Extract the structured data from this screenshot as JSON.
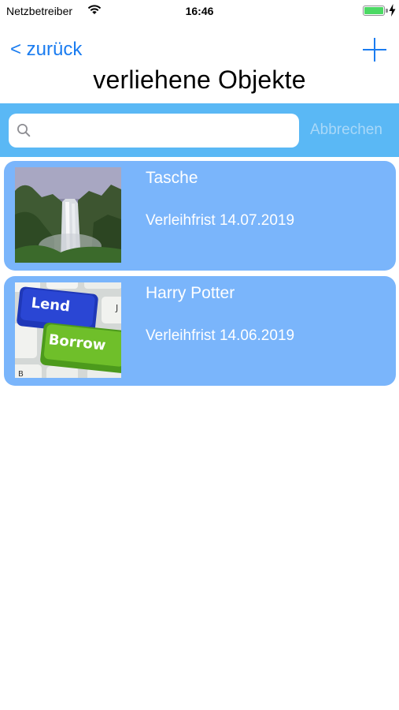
{
  "status_bar": {
    "carrier": "Netzbetreiber",
    "time": "16:46",
    "battery_level": 1.0
  },
  "nav": {
    "back_label": "< zurück",
    "title": "verliehene Objekte",
    "add_icon": "plus-icon"
  },
  "search": {
    "placeholder": "",
    "value": "",
    "cancel_label": "Abbrechen"
  },
  "items": [
    {
      "name": "Tasche",
      "due": "Verleihfrist 14.07.2019",
      "image": "waterfall-photo"
    },
    {
      "name": "Harry Potter",
      "due": "Verleihfrist 14.06.2019",
      "image": "lend-borrow-keyboard-photo"
    }
  ],
  "thumb_text": {
    "lend": "Lend",
    "borrow": "Borrow"
  },
  "colors": {
    "accent": "#1a7cf0",
    "search_bar_bg": "#5ab8f5",
    "card_bg": "#7ab5fb",
    "cancel_text": "#a9d8f8"
  }
}
